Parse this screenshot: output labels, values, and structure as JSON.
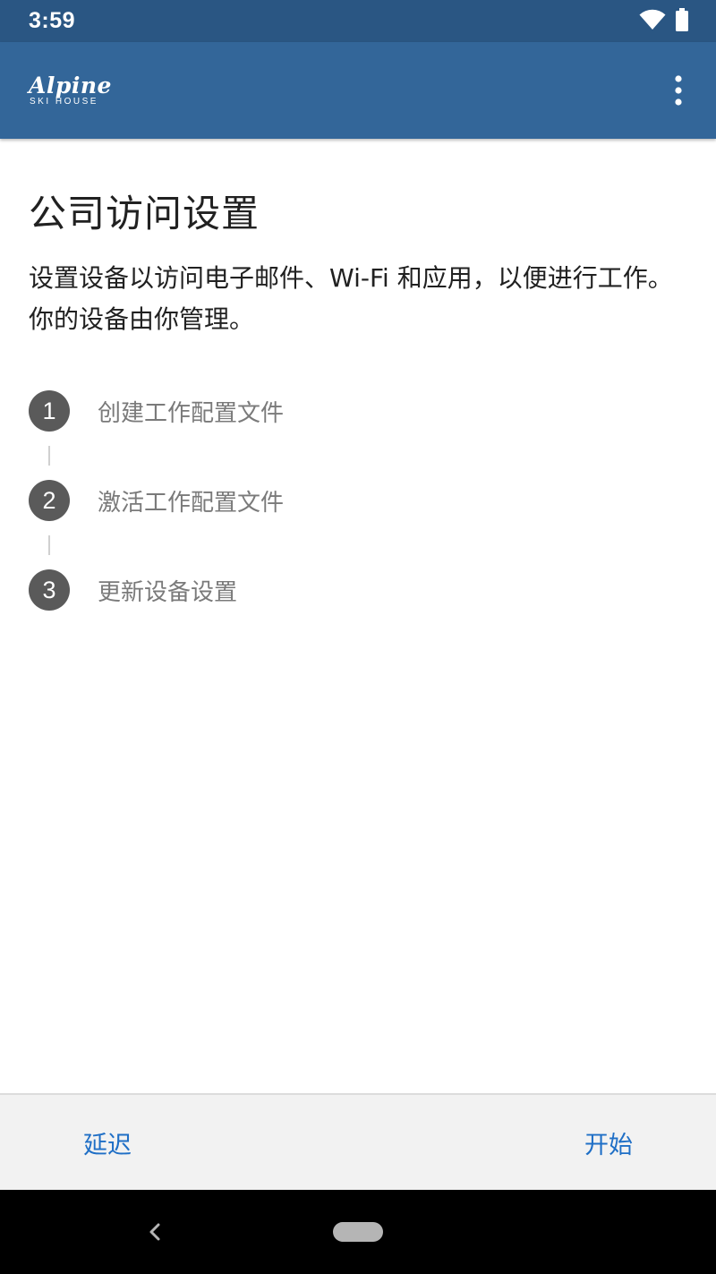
{
  "status_bar": {
    "time": "3:59",
    "icons": [
      "wifi-icon",
      "battery-icon"
    ]
  },
  "app_bar": {
    "logo_script": "Alpine",
    "logo_subtitle": "SKI HOUSE",
    "menu_icon": "more-vert-icon",
    "background_color": "#336699"
  },
  "content": {
    "title": "公司访问设置",
    "description": "设置设备以访问电子邮件、Wi-Fi 和应用，以便进行工作。你的设备由你管理。",
    "steps": [
      {
        "number": "1",
        "label": "创建工作配置文件"
      },
      {
        "number": "2",
        "label": "激活工作配置文件"
      },
      {
        "number": "3",
        "label": "更新设备设置"
      }
    ]
  },
  "actions": {
    "left_label": "延迟",
    "right_label": "开始",
    "accent_color": "#1f6fc6"
  },
  "nav_bar": {
    "back_icon": "back-chevron-icon",
    "home_icon": "home-pill-icon"
  }
}
